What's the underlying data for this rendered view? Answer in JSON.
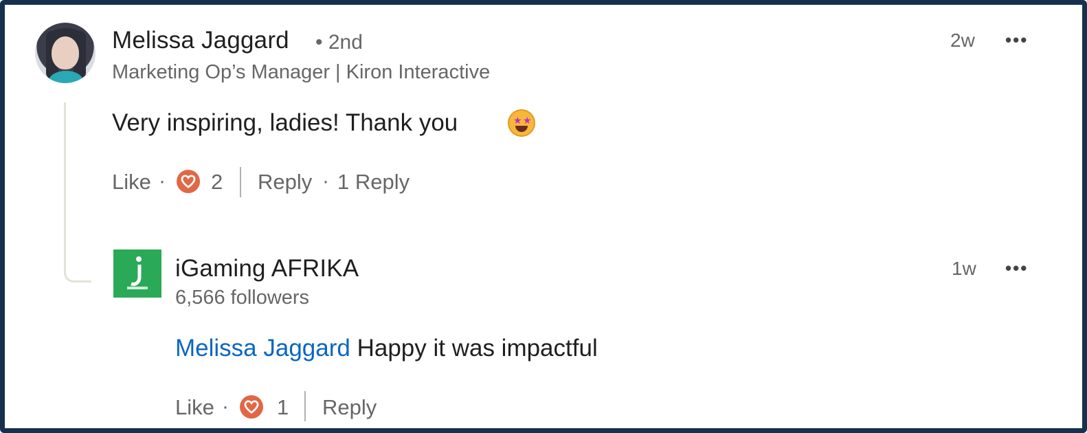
{
  "comment": {
    "author": "Melissa Jaggard",
    "degree": "• 2nd",
    "headline": "Marketing Op’s Manager | Kiron Interactive",
    "time": "2w",
    "more": "•••",
    "text": "Very inspiring, ladies! Thank you",
    "emoji": "star-struck-emoji",
    "like_label": "Like",
    "reaction_icon": "heart-icon",
    "reaction_count": "2",
    "reply_label": "Reply",
    "replies_count": "1 Reply"
  },
  "reply": {
    "author": "iGaming AFRIKA",
    "followers": "6,566 followers",
    "time": "1w",
    "more": "•••",
    "mention": "Melissa Jaggard",
    "text": "Happy it was impactful",
    "like_label": "Like",
    "reaction_icon": "heart-icon",
    "reaction_count": "1",
    "reply_label": "Reply"
  },
  "separator": "·",
  "colors": {
    "mention": "#0a66c2",
    "heart": "#e16745",
    "logo": "#2aa957",
    "frame": "#17304f"
  }
}
